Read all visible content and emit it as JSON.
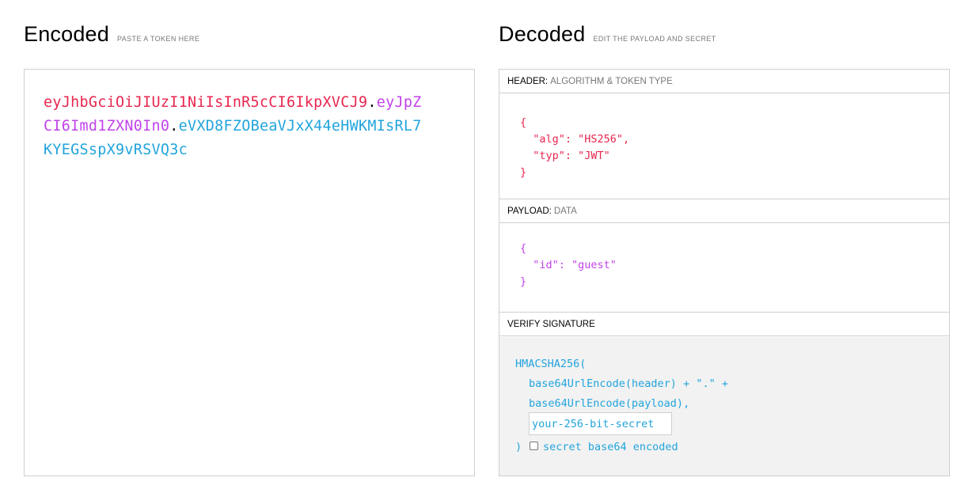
{
  "encoded": {
    "title": "Encoded",
    "subtitle": "PASTE A TOKEN HERE",
    "token_header": "eyJhbGciOiJIUzI1NiIsInR5cCI6IkpXVCJ9",
    "token_payload": "eyJpZCI6Imd1ZXN0In0",
    "token_signature": "eVXD8FZOBeaVJxX44eHWKMIsRL7KYEGSspX9vRSVQ3c",
    "dot": "."
  },
  "decoded": {
    "title": "Decoded",
    "subtitle": "EDIT THE PAYLOAD AND SECRET",
    "header_section": {
      "label": "HEADER:",
      "description": "ALGORITHM & TOKEN TYPE",
      "code": "{\n  \"alg\": \"HS256\",\n  \"typ\": \"JWT\"\n}"
    },
    "payload_section": {
      "label": "PAYLOAD:",
      "description": "DATA",
      "code": "{\n  \"id\": \"guest\"\n}"
    },
    "signature_section": {
      "label": "VERIFY SIGNATURE",
      "line1": "HMACSHA256(",
      "line2": "base64UrlEncode(header) + \".\" +",
      "line3": "base64UrlEncode(payload),",
      "secret_value": "your-256-bit-secret",
      "close_paren": ")",
      "checkbox_label": "secret base64 encoded",
      "checkbox_checked": false
    }
  },
  "colors": {
    "header": "#e8264f",
    "payload": "#c143e9",
    "signature": "#22a4dc"
  }
}
